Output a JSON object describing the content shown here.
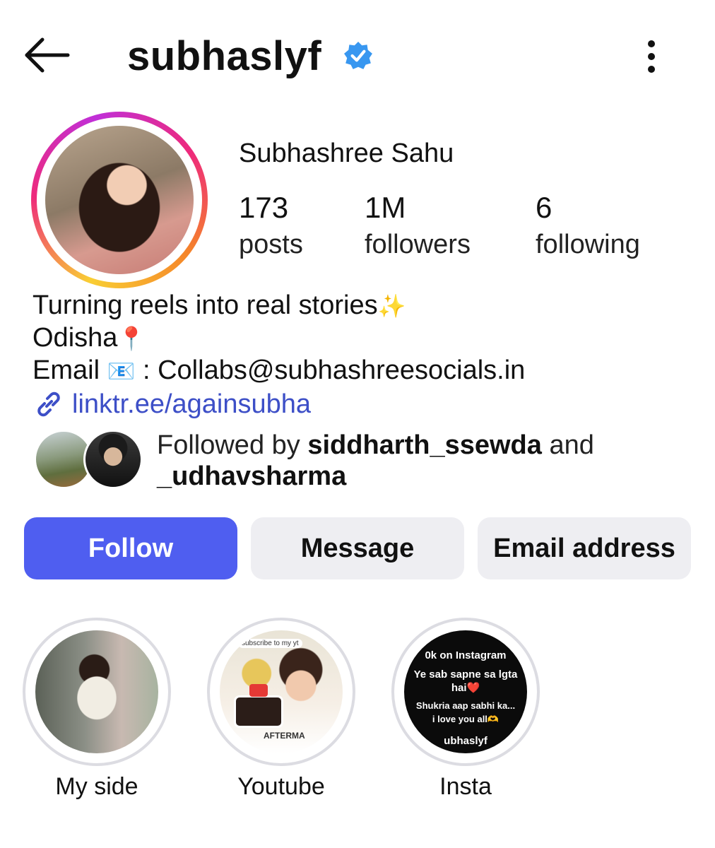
{
  "header": {
    "back_icon": "arrow-left-icon",
    "username": "subhaslyf",
    "verified_icon": "verified-badge-icon",
    "verified_color": "#3897f0",
    "more_icon": "more-vertical-icon"
  },
  "profile": {
    "full_name": "Subhashree Sahu",
    "stats": [
      {
        "value": "173",
        "label": "posts"
      },
      {
        "value": "1M",
        "label": "followers"
      },
      {
        "value": "6",
        "label": "following"
      }
    ],
    "bio": {
      "line1": "Turning reels into real stories",
      "line1_emoji": "✨",
      "line2": "Odisha",
      "line2_emoji": "📍",
      "line3_prefix": "Email",
      "line3_emoji": "📧",
      "line3_text": " : Collabs@subhashreesocials.in"
    },
    "link": {
      "icon": "link-icon",
      "text": "linktr.ee/againsubha",
      "color": "#3d4fc7"
    },
    "followed_by": {
      "prefix": "Followed by ",
      "user1": "siddharth_ssewda",
      "joiner": " and",
      "user2": "_udhavsharma"
    }
  },
  "actions": {
    "follow": "Follow",
    "message": "Message",
    "email": "Email address",
    "follow_color": "#4f5ef0"
  },
  "highlights": [
    {
      "label": "My side"
    },
    {
      "label": "Youtube",
      "overlay_text": "subscribe to my yt",
      "cake_text": "AFTERMA"
    },
    {
      "label": "Insta",
      "overlay_lines": [
        "0k on Instagram",
        "Ye sab sapne sa lgta",
        "hai❤️",
        "Shukria aap sabhi ka...",
        "i love you all🫶",
        "ubhaslyf"
      ]
    }
  ]
}
